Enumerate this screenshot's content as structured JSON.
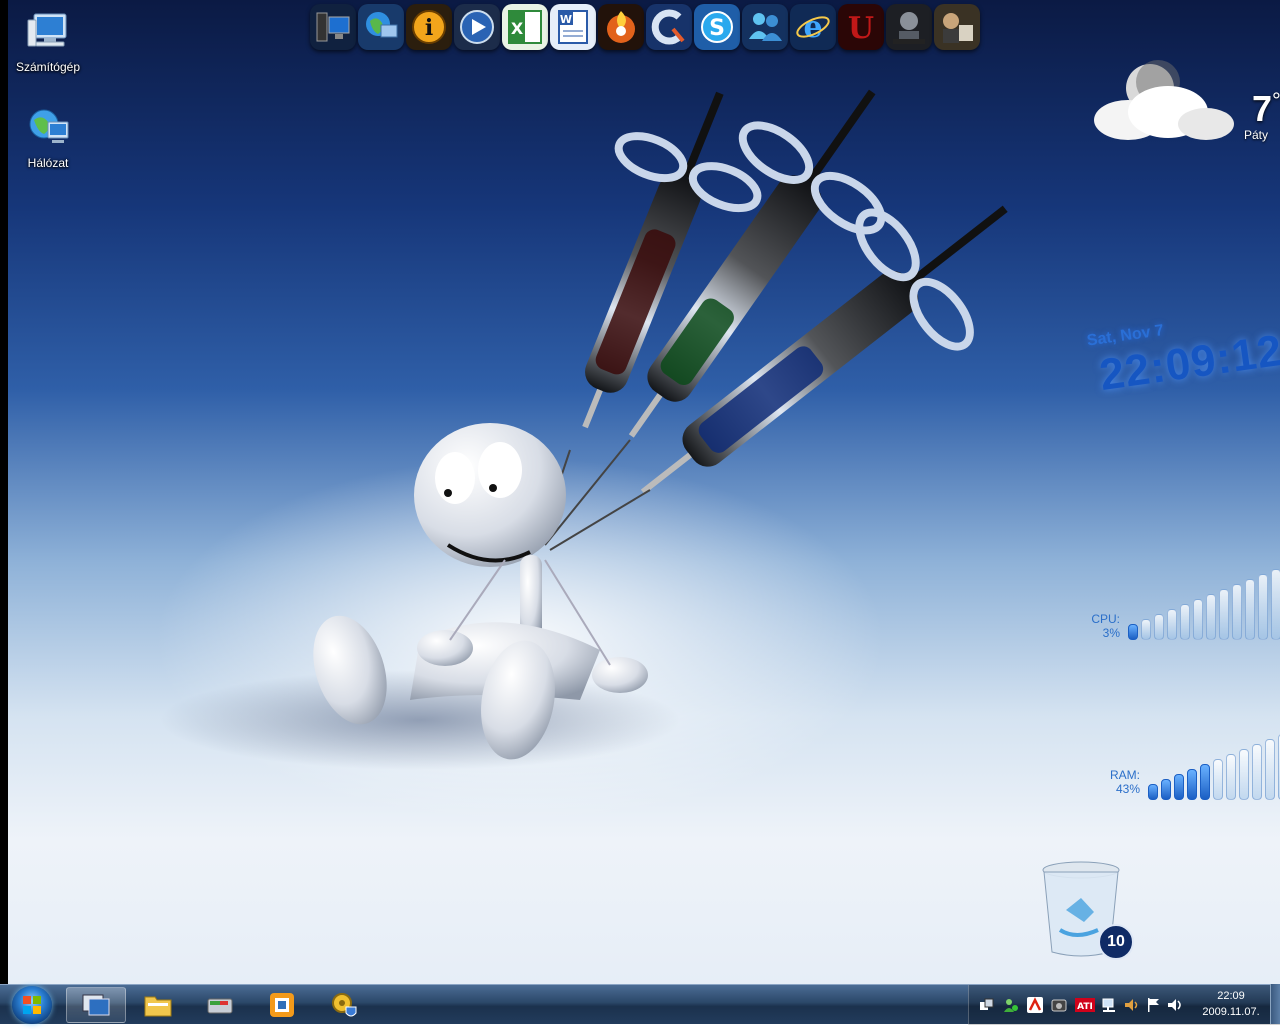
{
  "desktop_icons": [
    {
      "label": "Számítógép",
      "icon": "computer-icon"
    },
    {
      "label": "Hálózat",
      "icon": "network-icon"
    }
  ],
  "dock": [
    {
      "icon": "system-tower-icon"
    },
    {
      "icon": "network-globe-icon"
    },
    {
      "icon": "info-icon"
    },
    {
      "icon": "media-player-icon"
    },
    {
      "icon": "excel-icon"
    },
    {
      "icon": "word-icon"
    },
    {
      "icon": "nero-icon"
    },
    {
      "icon": "ccleaner-icon"
    },
    {
      "icon": "skype-icon"
    },
    {
      "icon": "messenger-icon"
    },
    {
      "icon": "internet-explorer-icon"
    },
    {
      "icon": "unreal-icon"
    },
    {
      "icon": "crysis-game-icon"
    },
    {
      "icon": "gta-iv-game-icon"
    }
  ],
  "weather": {
    "temperature": "7",
    "degree": "°",
    "city": "Páty"
  },
  "clock": {
    "date": "Sat, Nov 7",
    "time": "22:09:12"
  },
  "cpu": {
    "label": "CPU:",
    "value": "3%",
    "level": 0.03
  },
  "ram": {
    "label": "RAM:",
    "value": "43%",
    "level": 0.43
  },
  "recycle_bin": {
    "count": "10"
  },
  "taskbar": {
    "buttons": [
      {
        "icon": "window-switcher-icon",
        "active": true
      },
      {
        "icon": "file-explorer-icon",
        "active": false
      },
      {
        "icon": "disk-management-icon",
        "active": false
      },
      {
        "icon": "vmware-icon",
        "active": false
      },
      {
        "icon": "settings-shield-icon",
        "active": false
      }
    ],
    "tray_time": "22:09",
    "tray_date": "2009.11.07."
  },
  "colors": {
    "accent_blue": "#1656c2",
    "meter_on": "#1b5fc4"
  }
}
